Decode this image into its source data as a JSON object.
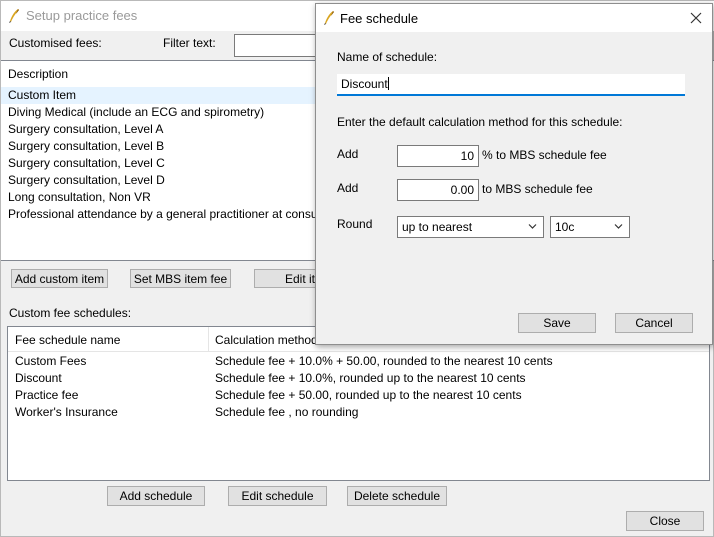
{
  "main": {
    "title": "Setup practice fees",
    "customised_fees_label": "Customised fees:",
    "filter_text_label": "Filter text:",
    "filter_text_value": "",
    "description_header": "Description",
    "items": [
      "Custom Item",
      "Diving Medical (include an ECG and spirometry)",
      "Surgery consultation, Level A",
      "Surgery consultation, Level B",
      "Surgery consultation, Level C",
      "Surgery consultation, Level D",
      "Long consultation, Non VR",
      "Professional attendance by a general practitioner at consulting r..."
    ],
    "buttons": {
      "add_custom_item": "Add custom item",
      "set_mbs_item_fee": "Set MBS item fee",
      "edit_item": "Edit ite",
      "add_schedule": "Add schedule",
      "edit_schedule": "Edit schedule",
      "delete_schedule": "Delete schedule",
      "close": "Close"
    },
    "custom_fee_schedules_label": "Custom fee schedules:",
    "schedule_columns": [
      "Fee schedule name",
      "Calculation method"
    ],
    "schedules": [
      {
        "name": "Custom Fees",
        "method": "Schedule fee  + 10.0% + 50.00, rounded to the nearest 10 cents"
      },
      {
        "name": "Discount",
        "method": "Schedule fee  + 10.0%, rounded up to the nearest 10 cents"
      },
      {
        "name": "Practice fee",
        "method": "Schedule fee  + 50.00, rounded up to the nearest 10 cents"
      },
      {
        "name": "Worker's Insurance",
        "method": "Schedule fee , no rounding"
      }
    ]
  },
  "dialog": {
    "title": "Fee schedule",
    "name_label": "Name of schedule:",
    "name_value": "Discount",
    "calc_label": "Enter the default calculation method for this schedule:",
    "add_label_1": "Add",
    "percent_value": "10",
    "percent_suffix": "% to MBS schedule fee",
    "add_label_2": "Add",
    "amount_value": "0.00",
    "amount_suffix": "to MBS schedule fee",
    "round_label": "Round",
    "round_mode": "up to nearest",
    "round_unit": "10c",
    "save_label": "Save",
    "cancel_label": "Cancel"
  },
  "icons": {
    "app": "quill-pen-icon",
    "close": "close-icon",
    "dropdown": "chevron-down-icon"
  },
  "colors": {
    "accent": "#0078d7",
    "title_disabled": "#9a9a9a"
  }
}
